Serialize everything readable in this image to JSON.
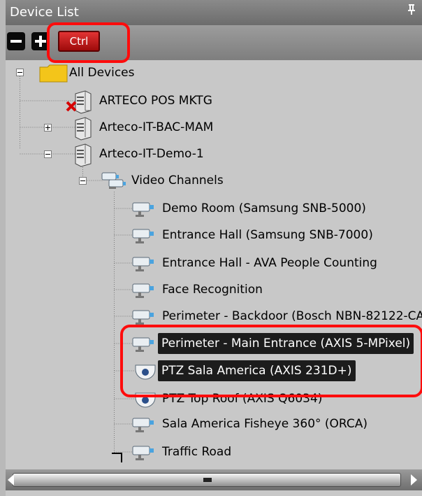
{
  "panel": {
    "title": "Device List",
    "pin_icon": "pin-icon"
  },
  "toolbar": {
    "collapse_icon": "minus-icon",
    "expand_icon": "plus-icon",
    "ctrl_label": "Ctrl"
  },
  "tree": {
    "root": {
      "label": "All Devices",
      "icon": "folder-icon",
      "state": "expanded"
    },
    "servers": [
      {
        "label": "ARTECO POS MKTG",
        "icon": "server-icon",
        "status": "offline",
        "state": "leaf"
      },
      {
        "label": "Arteco-IT-BAC-MAM",
        "icon": "server-icon",
        "state": "collapsed"
      },
      {
        "label": "Arteco-IT-Demo-1",
        "icon": "server-icon",
        "state": "expanded"
      }
    ],
    "group": {
      "label": "Video Channels",
      "icon": "cameras-icon",
      "state": "expanded"
    },
    "channels": [
      {
        "label": "Demo Room (Samsung SNB-5000)",
        "icon": "camera-icon"
      },
      {
        "label": "Entrance Hall (Samsung SNB-7000)",
        "icon": "camera-icon"
      },
      {
        "label": "Entrance Hall - AVA People Counting",
        "icon": "camera-icon"
      },
      {
        "label": "Face Recognition",
        "icon": "camera-icon"
      },
      {
        "label": "Perimeter - Backdoor (Bosch NBN-82122-CA",
        "icon": "camera-icon"
      },
      {
        "label": "Perimeter - Main Entrance (AXIS 5-MPixel)",
        "icon": "camera-icon",
        "selected": true
      },
      {
        "label": "PTZ Sala America (AXIS 231D+)",
        "icon": "dome-camera-icon",
        "selected": true
      },
      {
        "label": "PTZ Top Roof (AXIS Q6034)",
        "icon": "dome-camera-icon"
      },
      {
        "label": "Sala America Fisheye 360° (ORCA)",
        "icon": "camera-icon"
      },
      {
        "label": "Traffic Road",
        "icon": "camera-icon"
      }
    ]
  },
  "colors": {
    "highlight": "#ff0c0c",
    "selection": "#1c1c1c",
    "ctrl_button": "#c31d1d",
    "folder": "#f3c51a"
  }
}
